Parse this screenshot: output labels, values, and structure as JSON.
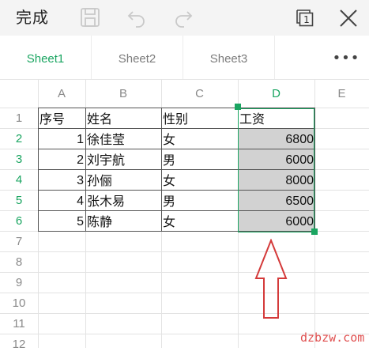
{
  "toolbar": {
    "done_label": "完成",
    "page_count": "1",
    "icons": [
      "save-icon",
      "undo-icon",
      "redo-icon",
      "page-count-icon",
      "close-icon"
    ]
  },
  "tabs": {
    "items": [
      {
        "label": "Sheet1",
        "active": true
      },
      {
        "label": "Sheet2",
        "active": false
      },
      {
        "label": "Sheet3",
        "active": false
      }
    ],
    "more_label": "•••"
  },
  "grid": {
    "columns": [
      "A",
      "B",
      "C",
      "D",
      "E"
    ],
    "selected_column": "D",
    "rows": [
      "1",
      "2",
      "3",
      "4",
      "5",
      "6",
      "7",
      "8",
      "9",
      "10",
      "11",
      "12"
    ],
    "selected_rows": [
      "2",
      "3",
      "4",
      "5",
      "6"
    ],
    "header_row": [
      "序号",
      "姓名",
      "性别",
      "工资"
    ],
    "data_rows": [
      [
        "1",
        "徐佳莹",
        "女",
        "6800"
      ],
      [
        "2",
        "刘宇航",
        "男",
        "6000"
      ],
      [
        "3",
        "孙俪",
        "女",
        "8000"
      ],
      [
        "4",
        "张木易",
        "男",
        "6500"
      ],
      [
        "5",
        "陈静",
        "女",
        "6000"
      ]
    ]
  },
  "colors": {
    "accent": "#1aa561",
    "selection_fill": "#d2d2d2",
    "annotation_arrow": "#d43a3a"
  },
  "watermark": "dzbzw.com"
}
